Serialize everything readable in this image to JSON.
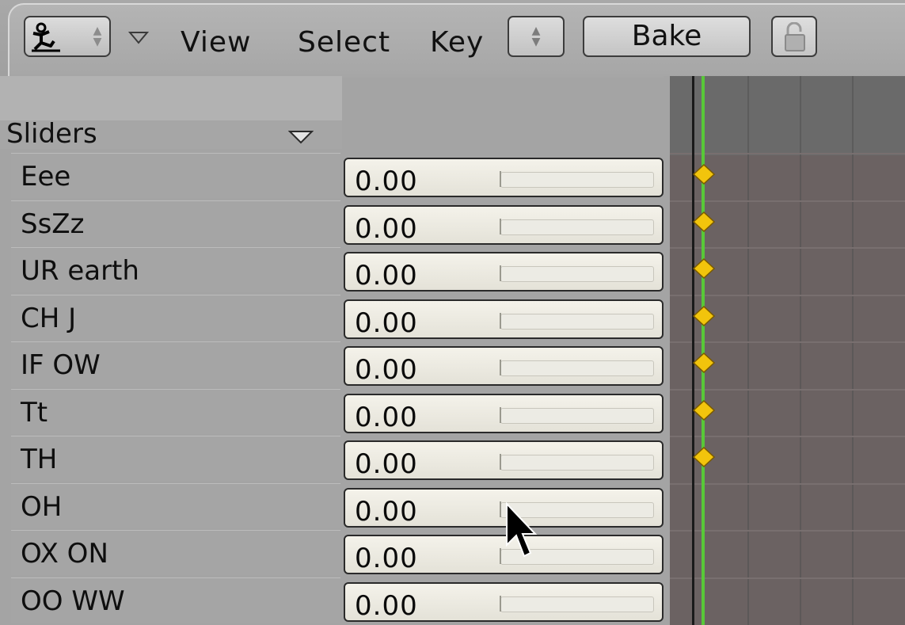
{
  "toolbar": {
    "editor_icon": "shape-action-editor-icon",
    "menus": [
      {
        "id": "view",
        "label": "View"
      },
      {
        "id": "select",
        "label": "Select"
      },
      {
        "id": "key",
        "label": "Key"
      }
    ],
    "bake_label": "Bake",
    "lock_icon": "lock-open-icon"
  },
  "channels": {
    "header_label": "Sliders",
    "rows": [
      {
        "name": "Eee",
        "value": "0.00",
        "has_key": true
      },
      {
        "name": "SsZz",
        "value": "0.00",
        "has_key": true
      },
      {
        "name": "UR earth",
        "value": "0.00",
        "has_key": true
      },
      {
        "name": "CH J",
        "value": "0.00",
        "has_key": true
      },
      {
        "name": "IF OW",
        "value": "0.00",
        "has_key": true
      },
      {
        "name": "Tt",
        "value": "0.00",
        "has_key": true
      },
      {
        "name": "TH",
        "value": "0.00",
        "has_key": true
      },
      {
        "name": "OH",
        "value": "0.00",
        "has_key": false
      },
      {
        "name": "OX ON",
        "value": "0.00",
        "has_key": false
      },
      {
        "name": "OO WW",
        "value": "0.00",
        "has_key": false
      }
    ]
  },
  "colors": {
    "current_frame": "#58c838",
    "keyframe": "#f2c40c",
    "timeline_bg": "#6b6262"
  }
}
